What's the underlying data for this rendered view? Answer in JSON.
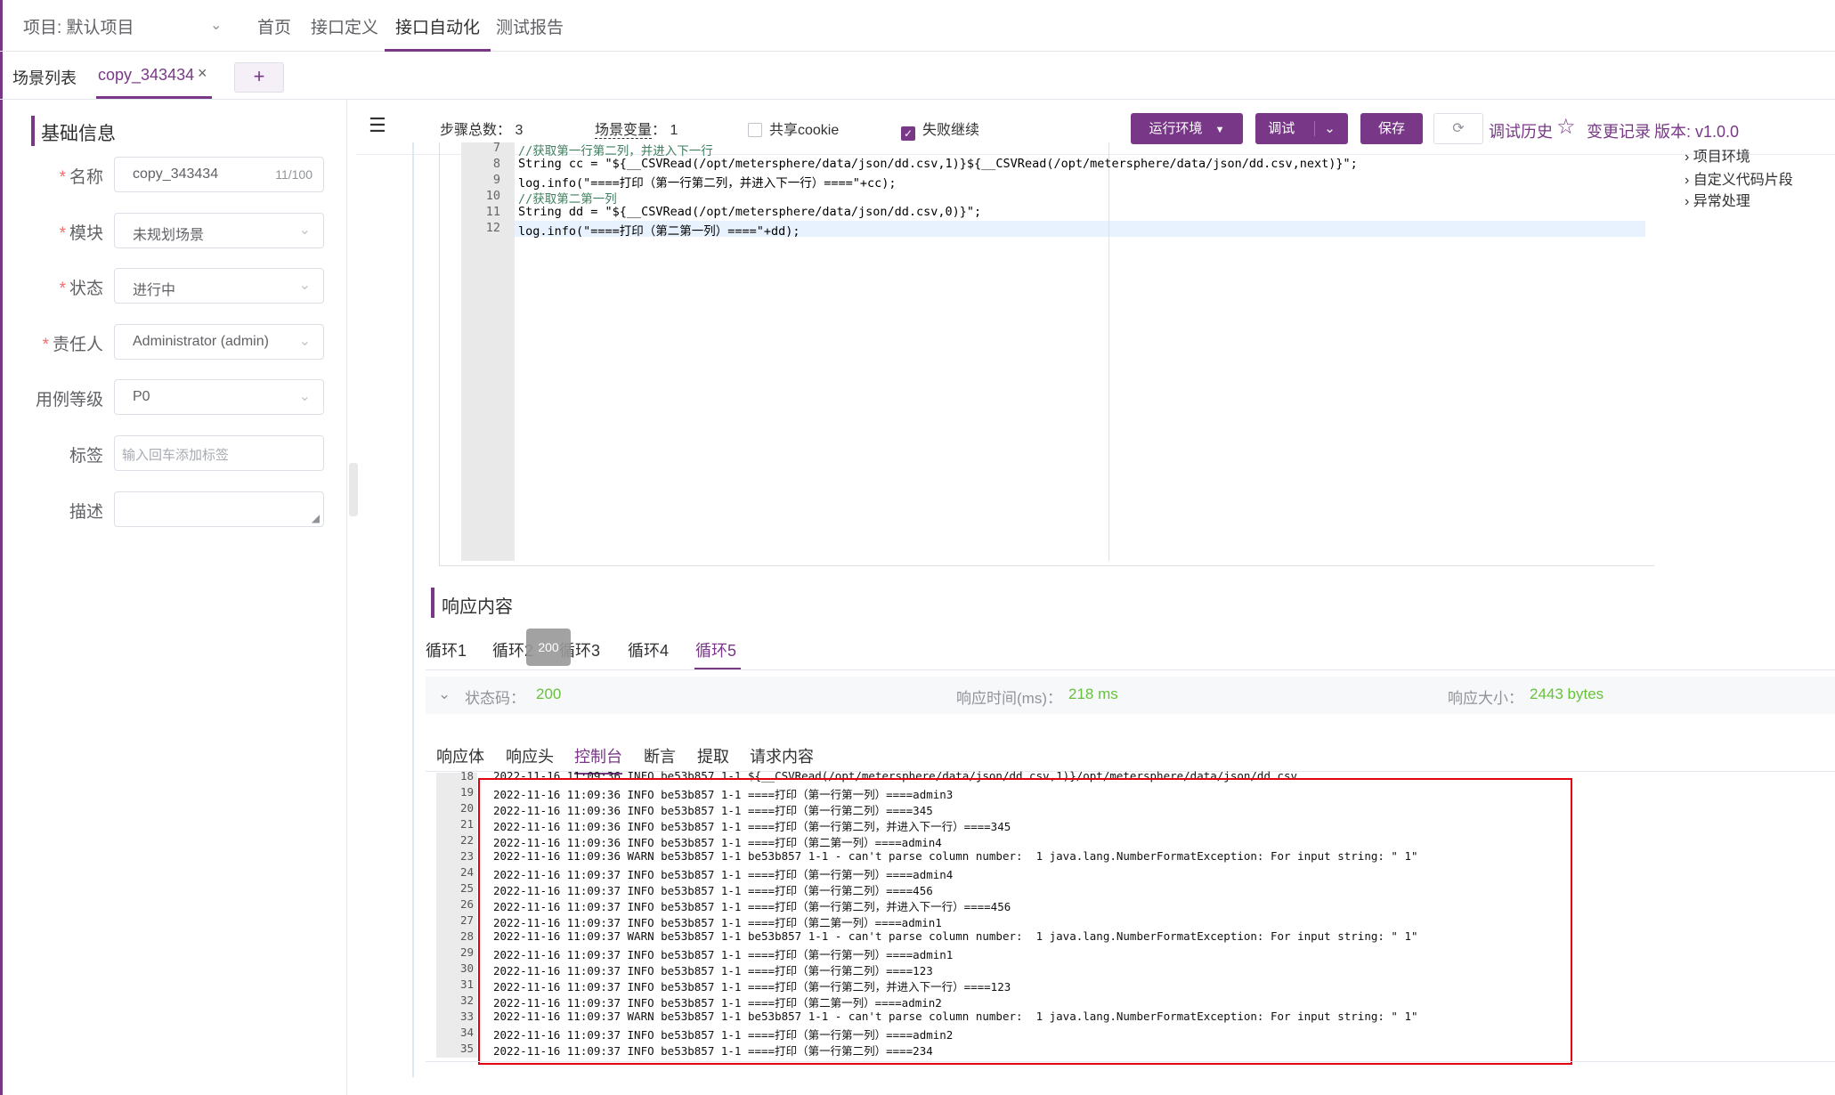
{
  "topnav": {
    "project": "项目: 默认项目",
    "items": [
      "首页",
      "接口定义",
      "接口自动化",
      "测试报告"
    ],
    "active_index": 2
  },
  "tabs": {
    "list_label": "场景列表",
    "active_tab": "copy_343434",
    "close": "×",
    "add": "+"
  },
  "form": {
    "section_title": "基础信息",
    "name_label": "名称",
    "name_value": "copy_343434",
    "name_count": "11/100",
    "module_label": "模块",
    "module_value": "未规划场景",
    "status_label": "状态",
    "status_value": "进行中",
    "owner_label": "责任人",
    "owner_value": "Administrator (admin)",
    "level_label": "用例等级",
    "level_value": "P0",
    "tag_label": "标签",
    "tag_placeholder": "输入回车添加标签",
    "desc_label": "描述",
    "required_mark": "*"
  },
  "toolbar": {
    "steps_label": "步骤总数：",
    "steps_value": "3",
    "vars_label": "场景变量",
    "vars_value": "：  1",
    "share_cookie": "共享cookie",
    "continue_on_fail": "失败继续",
    "env_button": "运行环境",
    "debug_button": "调试",
    "save_button": "保存",
    "history_link": "调试历史",
    "changes_link": "变更记录",
    "version": "版本: v1.0.0"
  },
  "editor": {
    "lines": [
      {
        "n": "7",
        "t": "//获取第一行第二列，并进入下一行",
        "c": "comment"
      },
      {
        "n": "8",
        "t": "String cc = \"${__CSVRead(/opt/metersphere/data/json/dd.csv,1)}${__CSVRead(/opt/metersphere/data/json/dd.csv,next)}\";",
        "c": "code"
      },
      {
        "n": "9",
        "t": "log.info(\"====打印（第一行第二列，并进入下一行）====\"+cc);",
        "c": "code"
      },
      {
        "n": "10",
        "t": "//获取第二第一列",
        "c": "comment"
      },
      {
        "n": "11",
        "t": "String dd = \"${__CSVRead(/opt/metersphere/data/json/dd.csv,0)}\";",
        "c": "code"
      },
      {
        "n": "12",
        "t": "log.info(\"====打印（第二第一列）====\"+dd);",
        "c": "code"
      }
    ]
  },
  "tree": [
    "项目环境",
    "自定义代码片段",
    "异常处理"
  ],
  "response": {
    "title": "响应内容",
    "loops": [
      "循环1",
      "循环2",
      "循环3",
      "循环4",
      "循环5"
    ],
    "active_loop": 4,
    "tooltip": "200",
    "status_label": "状态码：",
    "status_value": "200",
    "time_label": "响应时间(ms)：",
    "time_value": "218 ms",
    "size_label": "响应大小：",
    "size_value": "2443 bytes",
    "subtabs": [
      "响应体",
      "响应头",
      "控制台",
      "断言",
      "提取",
      "请求内容"
    ],
    "active_subtab": 2
  },
  "console": {
    "lines": [
      {
        "n": "18",
        "t": "2022-11-16 11:09:36 INFO be53b857 1-1 ${__CSVRead(/opt/metersphere/data/json/dd.csv,1)}/opt/metersphere/data/json/dd.csv"
      },
      {
        "n": "19",
        "t": "2022-11-16 11:09:36 INFO be53b857 1-1 ====打印（第一行第一列）====admin3"
      },
      {
        "n": "20",
        "t": "2022-11-16 11:09:36 INFO be53b857 1-1 ====打印（第一行第二列）====345"
      },
      {
        "n": "21",
        "t": "2022-11-16 11:09:36 INFO be53b857 1-1 ====打印（第一行第二列，并进入下一行）====345"
      },
      {
        "n": "22",
        "t": "2022-11-16 11:09:36 INFO be53b857 1-1 ====打印（第二第一列）====admin4"
      },
      {
        "n": "23",
        "t": "2022-11-16 11:09:36 WARN be53b857 1-1 be53b857 1-1 - can't parse column number:  1 java.lang.NumberFormatException: For input string: \" 1\""
      },
      {
        "n": "24",
        "t": "2022-11-16 11:09:37 INFO be53b857 1-1 ====打印（第一行第一列）====admin4"
      },
      {
        "n": "25",
        "t": "2022-11-16 11:09:37 INFO be53b857 1-1 ====打印（第一行第二列）====456"
      },
      {
        "n": "26",
        "t": "2022-11-16 11:09:37 INFO be53b857 1-1 ====打印（第一行第二列，并进入下一行）====456"
      },
      {
        "n": "27",
        "t": "2022-11-16 11:09:37 INFO be53b857 1-1 ====打印（第二第一列）====admin1"
      },
      {
        "n": "28",
        "t": "2022-11-16 11:09:37 WARN be53b857 1-1 be53b857 1-1 - can't parse column number:  1 java.lang.NumberFormatException: For input string: \" 1\""
      },
      {
        "n": "29",
        "t": "2022-11-16 11:09:37 INFO be53b857 1-1 ====打印（第一行第一列）====admin1"
      },
      {
        "n": "30",
        "t": "2022-11-16 11:09:37 INFO be53b857 1-1 ====打印（第一行第二列）====123"
      },
      {
        "n": "31",
        "t": "2022-11-16 11:09:37 INFO be53b857 1-1 ====打印（第一行第二列，并进入下一行）====123"
      },
      {
        "n": "32",
        "t": "2022-11-16 11:09:37 INFO be53b857 1-1 ====打印（第二第一列）====admin2"
      },
      {
        "n": "33",
        "t": "2022-11-16 11:09:37 WARN be53b857 1-1 be53b857 1-1 - can't parse column number:  1 java.lang.NumberFormatException: For input string: \" 1\""
      },
      {
        "n": "34",
        "t": "2022-11-16 11:09:37 INFO be53b857 1-1 ====打印（第一行第一列）====admin2"
      },
      {
        "n": "35",
        "t": "2022-11-16 11:09:37 INFO be53b857 1-1 ====打印（第一行第二列）====234"
      }
    ]
  },
  "colors": {
    "accent": "#783887",
    "success": "#67c23a",
    "highlight_box": "#e3000e"
  }
}
